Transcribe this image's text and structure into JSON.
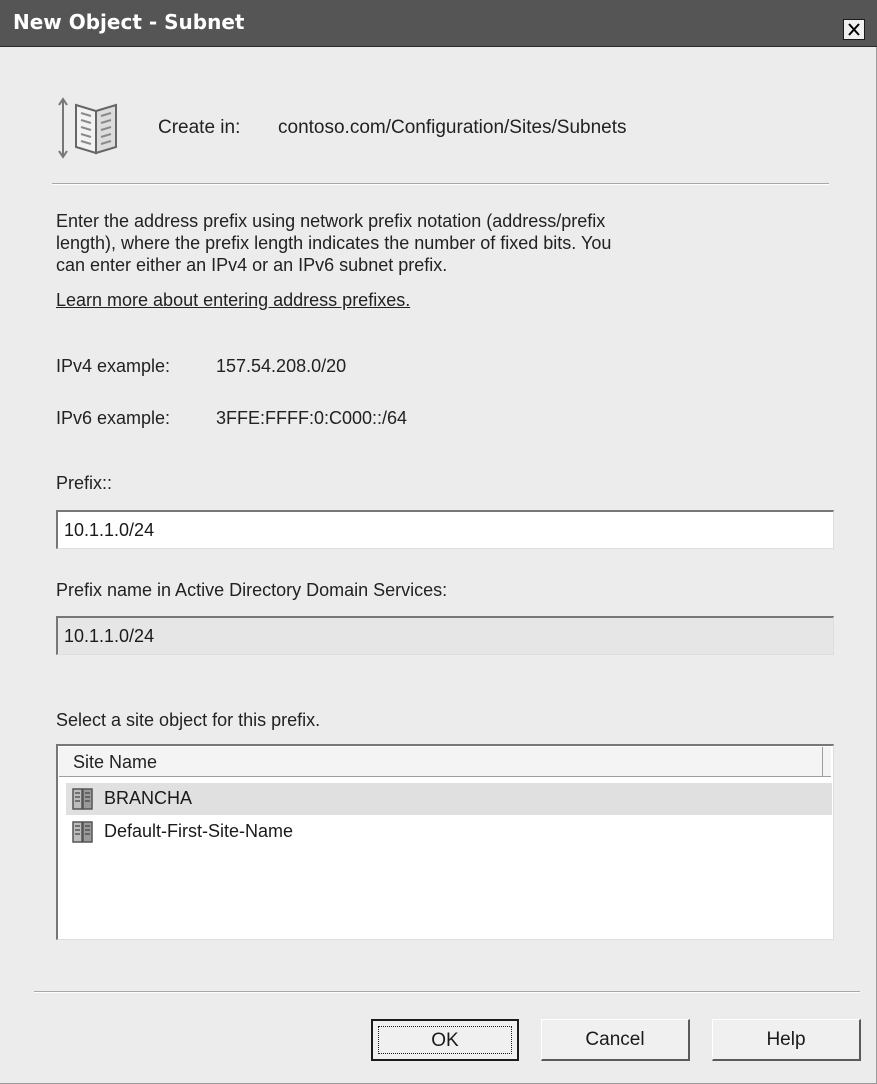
{
  "window": {
    "title": "New Object - Subnet",
    "close_symbol": "×"
  },
  "header": {
    "icon": "subnet-object-icon",
    "create_in_label": "Create in:",
    "create_in_path": "contoso.com/Configuration/Sites/Subnets"
  },
  "description": {
    "line1": "Enter the address prefix using network prefix notation (address/prefix",
    "line2": "length), where the prefix length indicates the number of fixed bits. You",
    "line3": "can enter either an IPv4 or an IPv6 subnet prefix.",
    "link": "Learn more about entering address prefixes."
  },
  "examples": {
    "ipv4_label": "IPv4 example:",
    "ipv4_value": "157.54.208.0/20",
    "ipv6_label": "IPv6 example:",
    "ipv6_value": "3FFE:FFFF:0:C000::/64"
  },
  "prefix": {
    "label": "Prefix::",
    "value": "10.1.1.0/24"
  },
  "prefix_name": {
    "label": "Prefix name in Active Directory Domain Services:",
    "value": "10.1.1.0/24"
  },
  "site_select": {
    "label": "Select a site object for this prefix.",
    "column_header": "Site Name",
    "rows": [
      {
        "name": "BRANCHA",
        "selected": true,
        "icon": "site-icon"
      },
      {
        "name": "Default-First-Site-Name",
        "selected": false,
        "icon": "site-icon"
      }
    ]
  },
  "buttons": {
    "ok": "OK",
    "cancel": "Cancel",
    "help": "Help"
  }
}
